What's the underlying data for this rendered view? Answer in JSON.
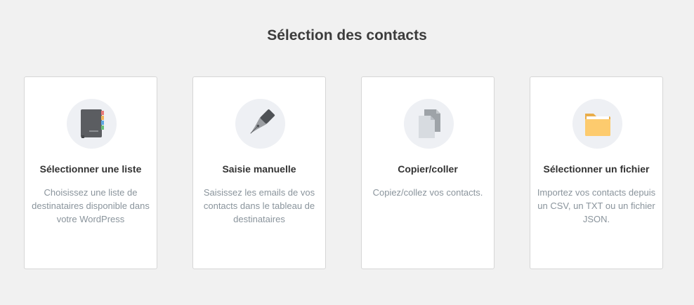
{
  "page": {
    "title": "Sélection des contacts"
  },
  "options": [
    {
      "title": "Sélectionner une liste",
      "description": "Choisissez une liste de destinataires disponible dans votre WordPress",
      "icon": "address-book-icon"
    },
    {
      "title": "Saisie manuelle",
      "description": "Saisissez les emails de vos contacts dans le tableau de destinataires",
      "icon": "pen-nib-icon"
    },
    {
      "title": "Copier/coller",
      "description": "Copiez/collez vos contacts.",
      "icon": "copy-documents-icon"
    },
    {
      "title": "Sélectionner un fichier",
      "description": "Importez vos contacts depuis un CSV, un TXT ou un fichier JSON.",
      "icon": "folder-icon"
    }
  ],
  "colors": {
    "background": "#f1f1f1",
    "card": "#ffffff",
    "icon_circle": "#eef0f4",
    "title": "#3c3c3c",
    "description": "#8a949c",
    "folder": "#fdcb6e"
  }
}
